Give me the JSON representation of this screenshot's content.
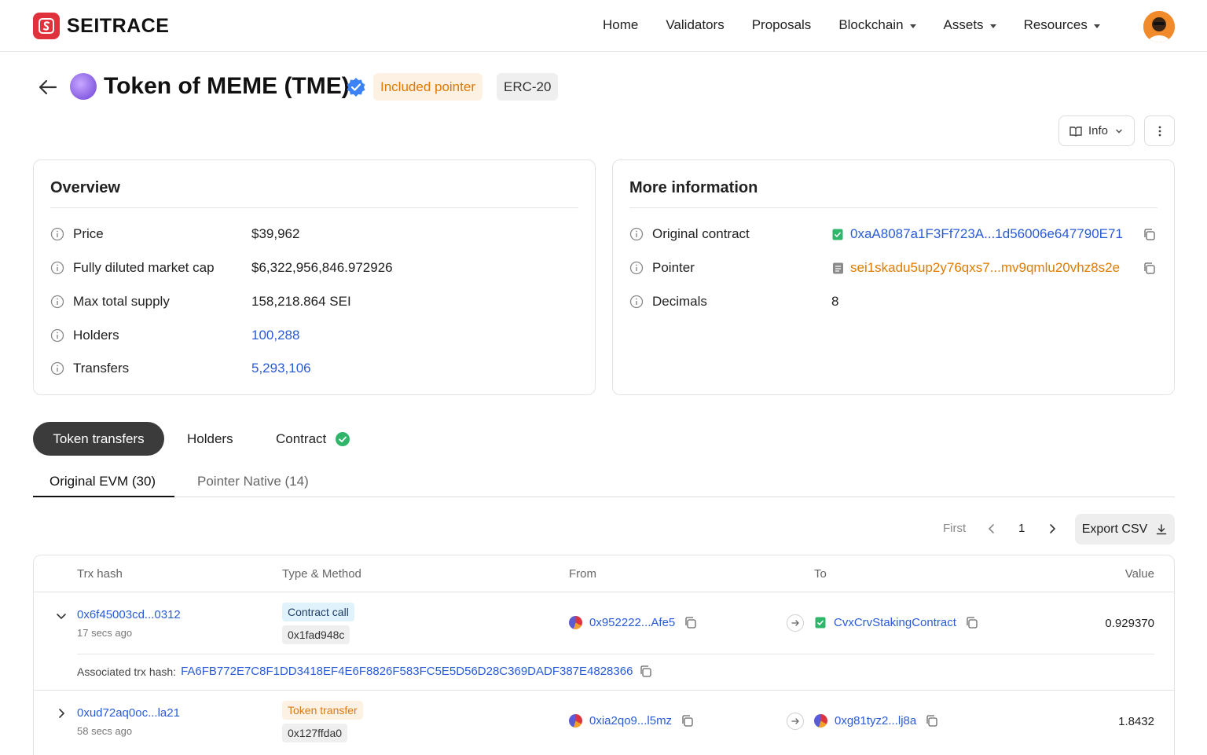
{
  "header": {
    "brand": "SEITRACE",
    "nav": [
      {
        "label": "Home",
        "has_caret": false
      },
      {
        "label": "Validators",
        "has_caret": false
      },
      {
        "label": "Proposals",
        "has_caret": false
      },
      {
        "label": "Blockchain",
        "has_caret": true
      },
      {
        "label": "Assets",
        "has_caret": true
      },
      {
        "label": "Resources",
        "has_caret": true
      }
    ]
  },
  "token": {
    "title": "Token of MEME (TME)",
    "tag_pointer": "Included pointer",
    "tag_standard": "ERC-20"
  },
  "actions": {
    "info_label": "Info"
  },
  "overview": {
    "title": "Overview",
    "rows": [
      {
        "label": "Price",
        "value": "$39,962"
      },
      {
        "label": "Fully diluted market cap",
        "value": "$6,322,956,846.972926"
      },
      {
        "label": "Max total supply",
        "value": "158,218.864 SEI"
      },
      {
        "label": "Holders",
        "value": "100,288"
      },
      {
        "label": "Transfers",
        "value": "5,293,106"
      }
    ]
  },
  "more_info": {
    "title": "More information",
    "rows": [
      {
        "label": "Original contract",
        "value": "0xaA8087a1F3Ff723A...1d56006e647790E71"
      },
      {
        "label": "Pointer",
        "value": "sei1skadu5up2y76qxs7...mv9qmlu20vhz8s2e"
      },
      {
        "label": "Decimals",
        "value": "8"
      }
    ]
  },
  "tabs": {
    "token_transfers": "Token transfers",
    "holders": "Holders",
    "contract": "Contract"
  },
  "sub_tabs": {
    "original": "Original EVM (30)",
    "pointer": "Pointer Native (14)"
  },
  "pagination": {
    "first": "First",
    "page": "1",
    "export": "Export CSV"
  },
  "table": {
    "headers": {
      "hash": "Trx hash",
      "type": "Type & Method",
      "from": "From",
      "to": "To",
      "value": "Value"
    },
    "rows": [
      {
        "hash": "0x6f45003cd...0312",
        "age": "17 secs ago",
        "type": "Contract call",
        "method": "0x1fad948c",
        "from": "0x952222...Afe5",
        "to": "CvxCrvStakingContract",
        "value": "0.929370",
        "assoc_label": "Associated trx hash:",
        "assoc_hash": "FA6FB772E7C8F1DD3418EF4E6F8826F583FC5E5D56D28C369DADF387E4828366"
      },
      {
        "hash": "0xud72aq0oc...la21",
        "age": "58 secs ago",
        "type": "Token transfer",
        "method": "0x127ffda0",
        "from": "0xia2qo9...l5mz",
        "to": "0xg81tyz2...lj8a",
        "value": "1.8432"
      }
    ]
  },
  "colors": {
    "accent_blue": "#2a5bd7",
    "accent_orange": "#e07b00",
    "brand_red": "#e0323c",
    "verified_blue": "#3b82f6",
    "success_green": "#2fb66a"
  }
}
